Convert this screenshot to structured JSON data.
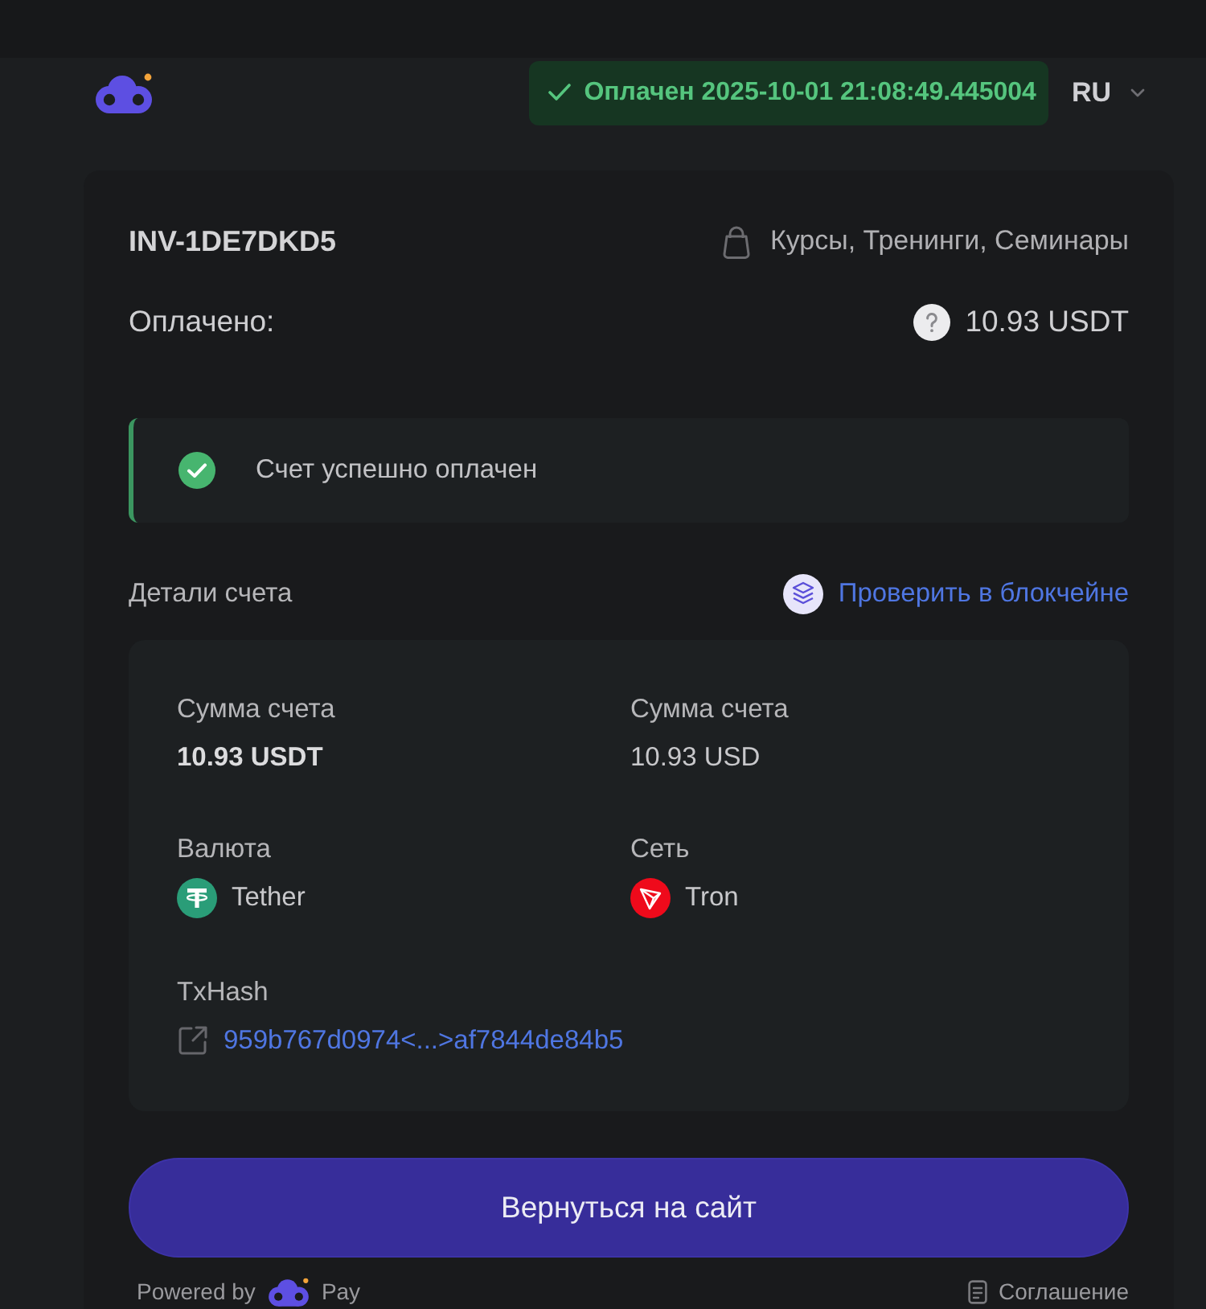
{
  "header": {
    "status": {
      "kind": "paid",
      "text": "Оплачен 2025-10-01 21:08:49.445004"
    },
    "language": "RU"
  },
  "invoice": {
    "id": "INV-1DE7DKD5",
    "category": "Курсы, Тренинги, Семинары",
    "paid_label": "Оплачено:",
    "paid_amount": "10.93 USDT"
  },
  "alert": {
    "kind": "success",
    "text": "Счет успешно оплачен"
  },
  "details": {
    "title": "Детали счета",
    "verify_link": "Проверить в блокчейне",
    "fields": [
      {
        "kind": "text",
        "label": "Сумма счета",
        "value": "10.93 USDT",
        "strong": true
      },
      {
        "kind": "text",
        "label": "Сумма счета",
        "value": "10.93 USD",
        "strong": false
      },
      {
        "kind": "currency",
        "label": "Валюта",
        "value": "Tether",
        "strong": false
      },
      {
        "kind": "network",
        "label": "Сеть",
        "value": "Tron",
        "strong": false
      },
      {
        "kind": "hash",
        "label": "TxHash",
        "value": "959b767d0974<...>af7844de84b5",
        "strong": false
      }
    ]
  },
  "return_button": {
    "label": "Вернуться на сайт"
  },
  "footer": {
    "powered_by": "Powered by",
    "brand": "Pay",
    "agreement": "Соглашение"
  }
}
